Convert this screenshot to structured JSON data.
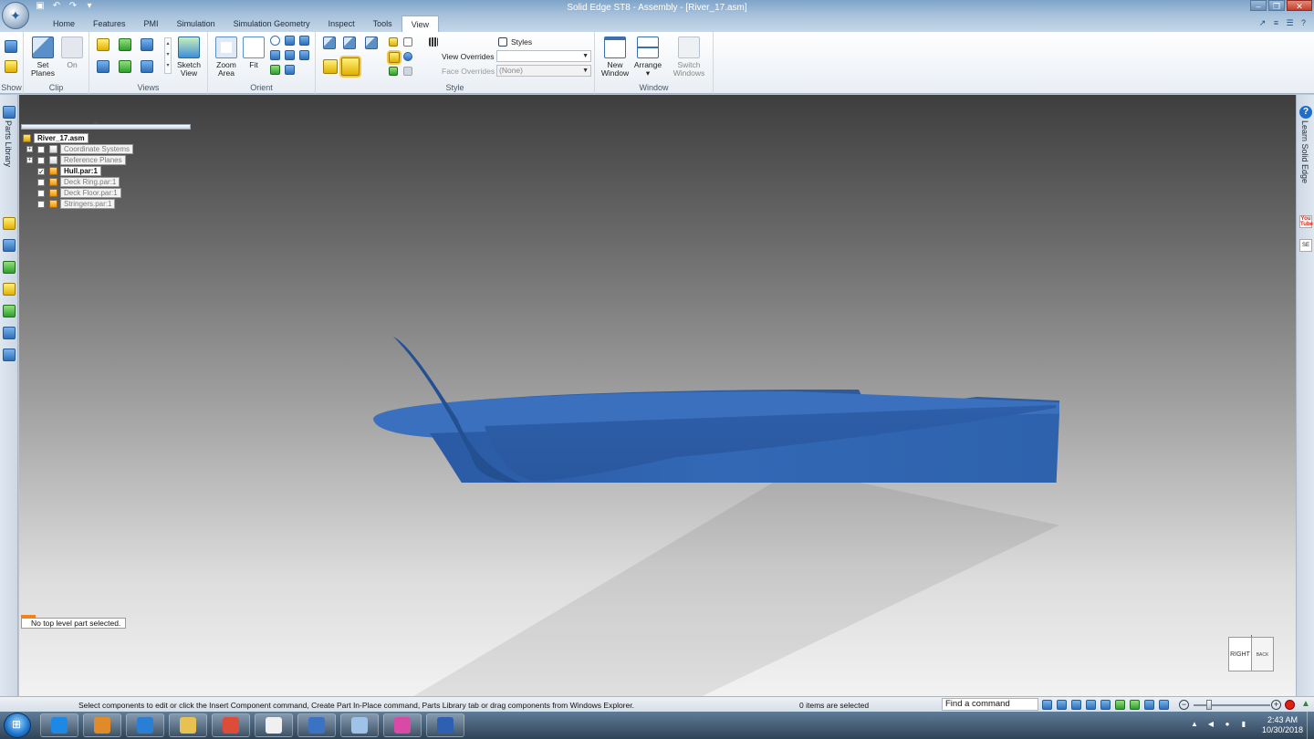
{
  "window": {
    "title": "Solid Edge ST8 - Assembly - [River_17.asm]",
    "controls": [
      "minimize",
      "restore",
      "close"
    ]
  },
  "ribbon": {
    "tabs": [
      {
        "label": "Home",
        "active": false
      },
      {
        "label": "Features",
        "active": false
      },
      {
        "label": "PMI",
        "active": false
      },
      {
        "label": "Simulation",
        "active": false
      },
      {
        "label": "Simulation Geometry",
        "active": false
      },
      {
        "label": "Inspect",
        "active": false
      },
      {
        "label": "Tools",
        "active": false
      },
      {
        "label": "View",
        "active": true
      }
    ],
    "groups": {
      "show": "Show",
      "clip": "Clip",
      "views": "Views",
      "orient": "Orient",
      "style": "Style",
      "window": "Window"
    },
    "buttons": {
      "set_planes_line1": "Set",
      "set_planes_line2": "Planes",
      "on": "On",
      "sketch_view_line1": "Sketch",
      "sketch_view_line2": "View",
      "zoom_area_line1": "Zoom",
      "zoom_area_line2": "Area",
      "fit": "Fit",
      "styles": "Styles",
      "view_overrides": "View Overrides",
      "face_overrides": "Face Overrides",
      "face_overrides_value": "(None)",
      "new_window_line1": "New",
      "new_window_line2": "Window",
      "arrange": "Arrange",
      "switch_windows_line1": "Switch",
      "switch_windows_line2": "Windows"
    }
  },
  "left_dock": {
    "parts_library": "Parts Library"
  },
  "right_dock": {
    "learn": "Learn Solid Edge",
    "youtube": "You Tube",
    "solidedge_badge": "SE"
  },
  "pathfinder": {
    "grip": "''''''''''''''",
    "root": "River_17.asm",
    "nodes": [
      {
        "label": "Coordinate Systems",
        "expandable": true,
        "checked": false,
        "icon": "coordinate-icon",
        "style": "dim"
      },
      {
        "label": "Reference Planes",
        "expandable": true,
        "checked": false,
        "icon": "plane-icon",
        "style": "dim"
      },
      {
        "label": "Hull.par:1",
        "expandable": false,
        "checked": true,
        "icon": "part-icon",
        "style": "bold"
      },
      {
        "label": "Deck Ring.par:1",
        "expandable": false,
        "checked": false,
        "icon": "part-icon",
        "style": "dim"
      },
      {
        "label": "Deck Floor.par:1",
        "expandable": false,
        "checked": false,
        "icon": "part-icon",
        "style": "dim"
      },
      {
        "label": "Stringers.par:1",
        "expandable": false,
        "checked": false,
        "icon": "part-icon",
        "style": "dim"
      }
    ],
    "quickview": "No top level part selected."
  },
  "viewcube": {
    "front": "RIGHT",
    "side": "BACK"
  },
  "statusbar": {
    "message": "Select components to edit or click the Insert Component command, Create Part In-Place command, Parts Library tab or drag components from Windows Explorer.",
    "selection": "0 items are selected",
    "find_command": "Find a command",
    "zoom_level": 0.2
  },
  "taskbar": {
    "apps": [
      "internet-explorer-icon",
      "media-player-icon",
      "paint-icon",
      "file-explorer-icon",
      "chrome-icon",
      "runner-icon",
      "security-icon",
      "solid-edge-icon",
      "itunes-icon",
      "virtualbox-icon"
    ],
    "time": "2:43 AM",
    "date": "10/30/2018"
  },
  "colors": {
    "hull": "#2f63b0",
    "accent": "#1e74c9"
  }
}
